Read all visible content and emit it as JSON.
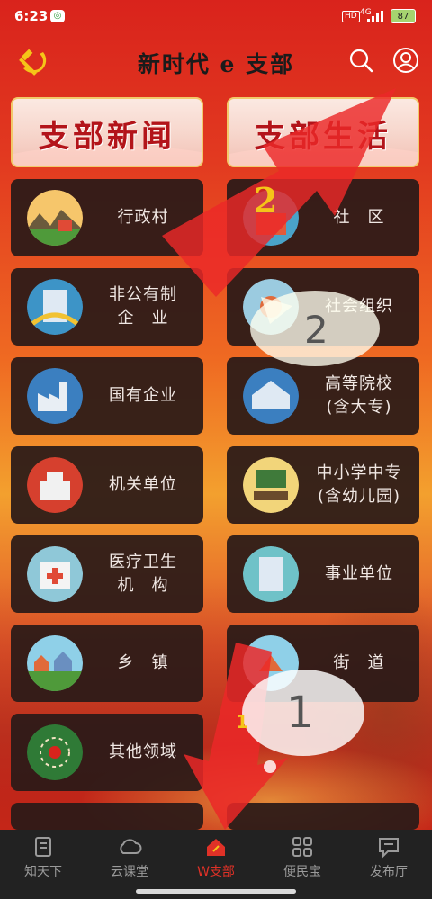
{
  "status_bar": {
    "time": "6:23",
    "wechat_icon": "wechat-icon",
    "hd": "HD",
    "network": "4G",
    "battery": "87"
  },
  "header": {
    "title": "新时代 e 支部",
    "logo_icon": "hammer-sickle-icon",
    "search_icon": "search-icon",
    "user_icon": "user-icon"
  },
  "banners": [
    {
      "label": "支部新闻"
    },
    {
      "label": "支部生活"
    }
  ],
  "tiles": [
    {
      "label": "行政村",
      "icon": "village-icon"
    },
    {
      "label": "社　区",
      "icon": "community-icon"
    },
    {
      "label": "非公有制\n企　业",
      "icon": "private-enterprise-icon"
    },
    {
      "label": "社会组织",
      "icon": "social-org-icon"
    },
    {
      "label": "国有企业",
      "icon": "factory-icon"
    },
    {
      "label": "高等院校\n(含大专)",
      "icon": "university-icon"
    },
    {
      "label": "机关单位",
      "icon": "government-icon"
    },
    {
      "label": "中小学中专\n(含幼儿园)",
      "icon": "school-icon"
    },
    {
      "label": "医疗卫生\n机　构",
      "icon": "hospital-icon"
    },
    {
      "label": "事业单位",
      "icon": "institution-icon"
    },
    {
      "label": "乡　镇",
      "icon": "township-icon"
    },
    {
      "label": "街　道",
      "icon": "street-icon"
    },
    {
      "label": "其他领域",
      "icon": "other-fields-icon"
    }
  ],
  "annotations": {
    "step1": "1",
    "step2": "2"
  },
  "nav": [
    {
      "label": "知天下",
      "icon": "document-icon",
      "active": false
    },
    {
      "label": "云课堂",
      "icon": "cloud-icon",
      "active": false
    },
    {
      "label": "W支部",
      "icon": "home-icon",
      "active": true
    },
    {
      "label": "便民宝",
      "icon": "grid-icon",
      "active": false
    },
    {
      "label": "发布厅",
      "icon": "message-icon",
      "active": false
    }
  ],
  "colors": {
    "primary_red": "#d9231c",
    "tile_bg": "#2a1a18",
    "nav_active": "#e03127",
    "nav_inactive": "#9a9a9a",
    "banner_text": "#b3141a"
  }
}
